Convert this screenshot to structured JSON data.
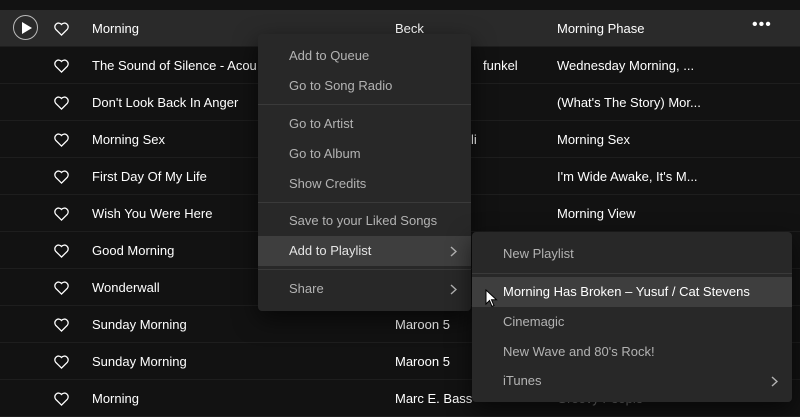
{
  "tracks": [
    {
      "title": "Morning",
      "artist": "Beck",
      "album": "Morning Phase"
    },
    {
      "title": "The Sound of Silence - Acou",
      "artist": "funkel",
      "album": "Wednesday Morning, ..."
    },
    {
      "title": "Don't Look Back In Anger",
      "artist": "",
      "album": "(What's The Story) Mor..."
    },
    {
      "title": "Morning Sex",
      "artist": "li",
      "album": "Morning Sex"
    },
    {
      "title": "First Day Of My Life",
      "artist": "",
      "album": "I'm Wide Awake, It's M..."
    },
    {
      "title": "Wish You Were Here",
      "artist": "",
      "album": "Morning View"
    },
    {
      "title": "Good Morning",
      "artist": "",
      "album": ""
    },
    {
      "title": "Wonderwall",
      "artist": "",
      "album": ""
    },
    {
      "title": "Sunday Morning",
      "artist": "Maroon 5",
      "album": ""
    },
    {
      "title": "Sunday Morning",
      "artist": "Maroon 5",
      "album": ""
    },
    {
      "title": "Morning",
      "artist": "Marc E. Bass",
      "album": "Groovy People"
    }
  ],
  "row_more": "•••",
  "context_menu": {
    "add_to_queue": "Add to Queue",
    "go_to_song_radio": "Go to Song Radio",
    "go_to_artist": "Go to Artist",
    "go_to_album": "Go to Album",
    "show_credits": "Show Credits",
    "save_liked": "Save to your Liked Songs",
    "add_to_playlist": "Add to Playlist",
    "share": "Share"
  },
  "playlist_submenu": {
    "new_playlist": "New Playlist",
    "items": [
      "Morning Has Broken – Yusuf / Cat Stevens",
      "Cinemagic",
      "New Wave and 80's Rock!",
      "iTunes"
    ]
  },
  "colors": {
    "background": "#121212",
    "menu": "#282828",
    "hover": "#3e3e3e"
  },
  "icons": {
    "play": "play-icon",
    "heart": "heart-icon",
    "chevron": "chevron-right-icon",
    "cursor": "cursor-icon"
  }
}
